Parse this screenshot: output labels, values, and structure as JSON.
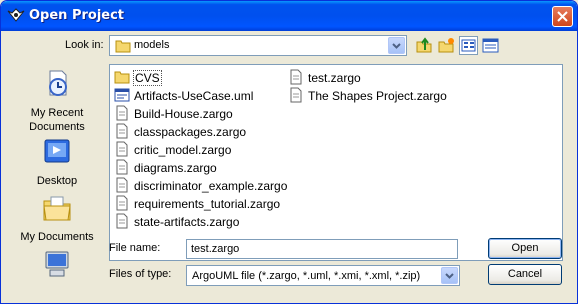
{
  "window": {
    "title": "Open Project"
  },
  "lookin": {
    "label": "Look in:",
    "value": "models"
  },
  "places": [
    {
      "label_line1": "My Recent",
      "label_line2": "Documents",
      "icon": "recent-documents-icon"
    },
    {
      "label_line1": "Desktop",
      "label_line2": "",
      "icon": "desktop-icon"
    },
    {
      "label_line1": "My Documents",
      "label_line2": "",
      "icon": "my-documents-icon"
    },
    {
      "label_line1": "",
      "label_line2": "",
      "icon": "my-computer-icon"
    }
  ],
  "files": [
    {
      "name": "CVS",
      "kind": "folder"
    },
    {
      "name": "Artifacts-UseCase.uml",
      "kind": "uml"
    },
    {
      "name": "Build-House.zargo",
      "kind": "doc"
    },
    {
      "name": "classpackages.zargo",
      "kind": "doc"
    },
    {
      "name": "critic_model.zargo",
      "kind": "doc"
    },
    {
      "name": "diagrams.zargo",
      "kind": "doc"
    },
    {
      "name": "discriminator_example.zargo",
      "kind": "doc"
    },
    {
      "name": "requirements_tutorial.zargo",
      "kind": "doc"
    },
    {
      "name": "state-artifacts.zargo",
      "kind": "doc"
    },
    {
      "name": "test.zargo",
      "kind": "doc"
    },
    {
      "name": "The Shapes Project.zargo",
      "kind": "doc"
    }
  ],
  "filename": {
    "label": "File name:",
    "value": "test.zargo"
  },
  "filetype": {
    "label": "Files of type:",
    "value": "ArgoUML file (*.zargo, *.uml, *.xmi, *.xml, *.zip)"
  },
  "buttons": {
    "open": "Open",
    "cancel": "Cancel"
  },
  "colors": {
    "titlebar": "#0054e3",
    "face": "#ece9d8",
    "border": "#7f9db9",
    "close": "#d1461c"
  }
}
